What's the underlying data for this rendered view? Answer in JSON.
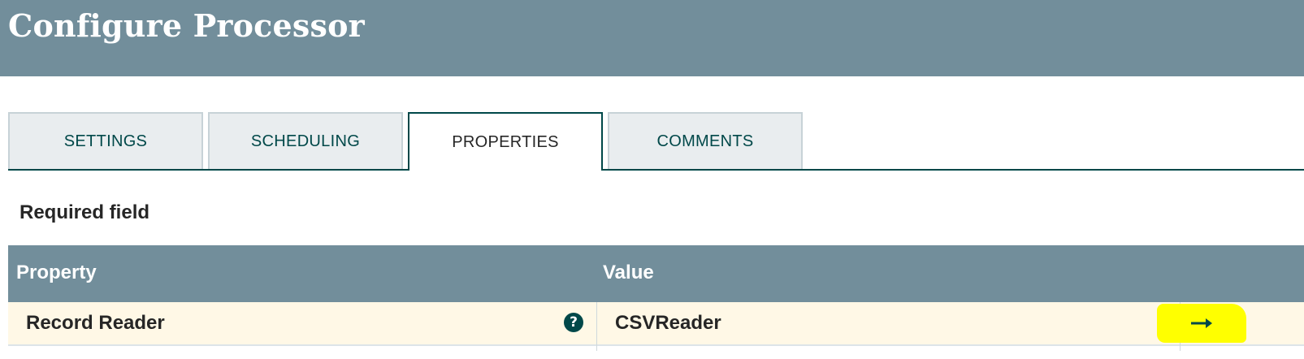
{
  "dialog": {
    "title": "Configure Processor"
  },
  "tabs": [
    {
      "label": "SETTINGS",
      "active": false
    },
    {
      "label": "SCHEDULING",
      "active": false
    },
    {
      "label": "PROPERTIES",
      "active": true
    },
    {
      "label": "COMMENTS",
      "active": false
    }
  ],
  "properties": {
    "required_label": "Required field",
    "columns": {
      "property": "Property",
      "value": "Value"
    },
    "rows": [
      {
        "property": "Record Reader",
        "help_icon": "help-circle-icon",
        "value": "CSVReader",
        "action_icon": "arrow-right-icon"
      }
    ]
  },
  "colors": {
    "header_bg": "#728e9b",
    "accent": "#004849",
    "row_bg": "#fff8e6",
    "highlight": "#ffff00"
  }
}
